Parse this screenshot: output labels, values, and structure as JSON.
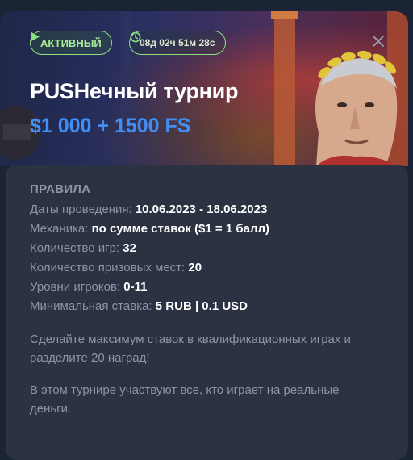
{
  "badges": {
    "status": "АКТИВНЫЙ",
    "timer": "08д 02ч 51м 28с"
  },
  "hero": {
    "title": "PUSHечный турнир",
    "prize": "$1 000 + 1500 FS"
  },
  "rules": {
    "heading": "ПРАВИЛА",
    "rows": [
      {
        "label": "Даты проведения: ",
        "value": "10.06.2023 - 18.06.2023"
      },
      {
        "label": "Механика: ",
        "value": "по сумме ставок ($1 = 1 балл)"
      },
      {
        "label": "Количество игр: ",
        "value": "32"
      },
      {
        "label": "Количество призовых мест: ",
        "value": "20"
      },
      {
        "label": "Уровни игроков: ",
        "value": "0-11"
      },
      {
        "label": "Минимальная ставка: ",
        "value": "5 RUB | 0.1 USD"
      }
    ],
    "paragraph1": "Сделайте максимум ставок в квалификационных играх и разделите 20 наград!",
    "paragraph2": "В этом турнире участвуют все, кто играет на реальные деньги."
  },
  "colors": {
    "accent_green": "#8ee07e",
    "prize_blue": "#3f8ff5",
    "panel": "#2b3343",
    "background": "#1b2434"
  }
}
